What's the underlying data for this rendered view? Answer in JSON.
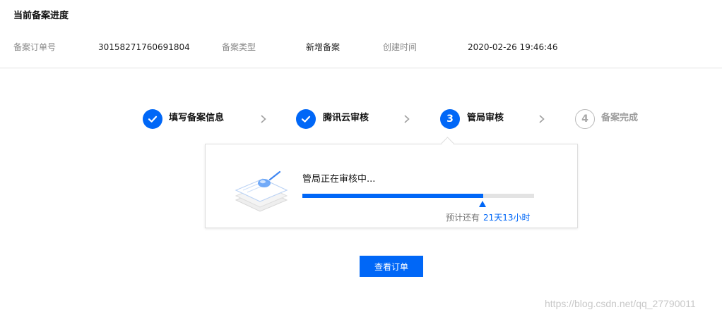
{
  "header": {
    "title": "当前备案进度",
    "order_no_label": "备案订单号",
    "order_no": "30158271760691804",
    "type_label": "备案类型",
    "type_value": "新增备案",
    "created_label": "创建时间",
    "created_value": "2020-02-26 19:46:46"
  },
  "steps": [
    {
      "label": "填写备案信息",
      "status": "done"
    },
    {
      "label": "腾讯云审核",
      "status": "done"
    },
    {
      "number": "3",
      "label": "管局审核",
      "status": "active"
    },
    {
      "number": "4",
      "label": "备案完成",
      "status": "pending"
    }
  ],
  "progress": {
    "status_text": "管局正在审核中...",
    "percent": 78,
    "eta_label": "预计还有",
    "eta_value": "21天13小时"
  },
  "view_order_button": "查看订单",
  "watermark": "https://blog.csdn.net/qq_27790011",
  "colors": {
    "accent": "#0067f7",
    "track": "#e3e3e3",
    "muted_text": "#888888"
  }
}
